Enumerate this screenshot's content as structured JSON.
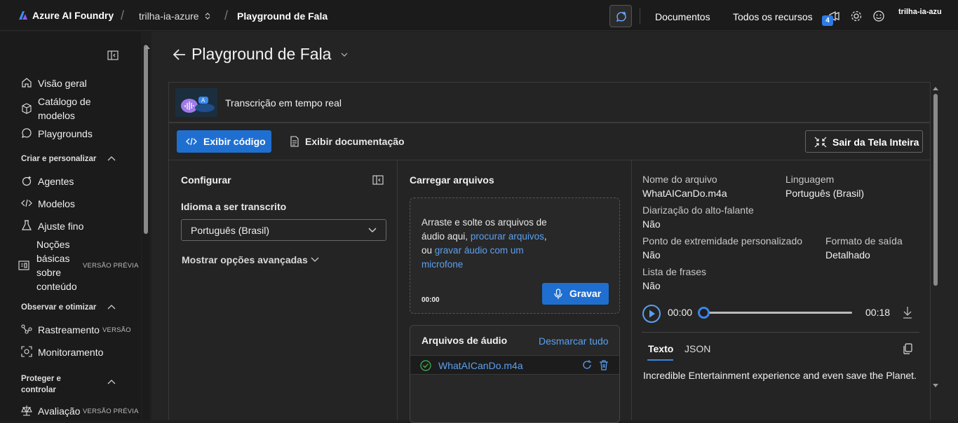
{
  "topbar": {
    "brand": "Azure AI Foundry",
    "project": "trilha-ia-azure",
    "page": "Playground de Fala",
    "docs": "Documentos",
    "all_resources": "Todos os recursos",
    "notifications_count": "4",
    "user": "trilha-ia-azu"
  },
  "sidebar": {
    "items_top": [
      {
        "label": "Visão geral",
        "icon": "home-icon"
      },
      {
        "label": "Catálogo de modelos",
        "icon": "cube-icon"
      },
      {
        "label": "Playgrounds",
        "icon": "chat-icon"
      }
    ],
    "section1": "Criar e personalizar",
    "items_s1": [
      {
        "label": "Agentes",
        "icon": "agent-icon"
      },
      {
        "label": "Modelos",
        "icon": "code-icon"
      },
      {
        "label": "Ajuste fino",
        "icon": "flask-icon"
      },
      {
        "label": "Noções básicas sobre conteúdo",
        "icon": "content-icon",
        "tag": "VERSÃO PRÉVIA"
      }
    ],
    "section2": "Observar e otimizar",
    "items_s2": [
      {
        "label": "Rastreamento",
        "icon": "trace-icon",
        "tag": "VERSÃO"
      },
      {
        "label": "Monitoramento",
        "icon": "monitor-icon"
      }
    ],
    "section3": "Proteger e controlar",
    "items_s3": [
      {
        "label": "Avaliação",
        "icon": "scale-icon",
        "tag": "VERSÃO PRÉVIA"
      }
    ]
  },
  "page": {
    "title": "Playground de Fala",
    "hero_title": "Transcrição em tempo real"
  },
  "toolbar": {
    "view_code": "Exibir código",
    "view_docs": "Exibir documentação",
    "exit_fullscreen": "Sair da Tela Inteira"
  },
  "configure": {
    "title": "Configurar",
    "language_label": "Idioma a ser transcrito",
    "language_value": "Português (Brasil)",
    "advanced": "Mostrar opções avançadas"
  },
  "upload": {
    "title": "Carregar arquivos",
    "drop_text": "Arraste e solte os arquivos de áudio aqui,",
    "browse_link": "procurar arquivos",
    "or": ", ou",
    "record_link": "gravar áudio com um microfone",
    "timer": "00:00",
    "record_button": "Gravar",
    "files_title": "Arquivos de áudio",
    "clear_all": "Desmarcar tudo",
    "files": [
      {
        "name": "WhatAICanDo.m4a"
      }
    ]
  },
  "details": {
    "file_name_label": "Nome do arquivo",
    "file_name": "WhatAICanDo.m4a",
    "language_label": "Linguagem",
    "language": "Português (Brasil)",
    "diarization_label": "Diarização do alto-falante",
    "diarization": "Não",
    "endpoint_label": "Ponto de extremidade personalizado",
    "endpoint": "Não",
    "output_label": "Formato de saída",
    "output": "Detalhado",
    "phrases_label": "Lista de frases",
    "phrases": "Não",
    "current_time": "00:00",
    "total_time": "00:18",
    "tab_text": "Texto",
    "tab_json": "JSON",
    "transcript": "Incredible Entertainment experience and even save the Planet."
  }
}
